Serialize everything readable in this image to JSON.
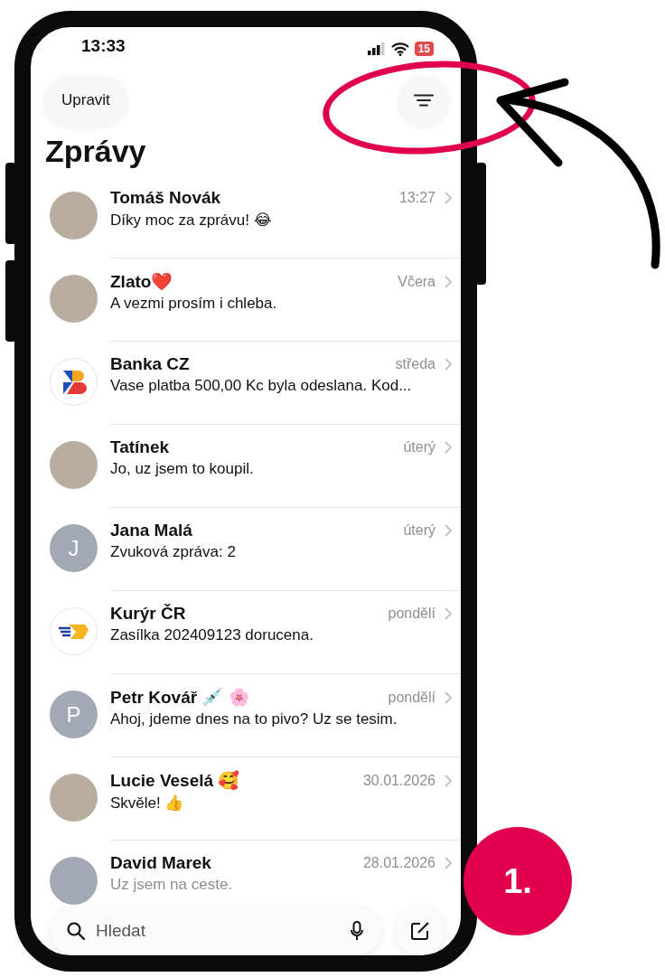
{
  "status_bar": {
    "time": "13:33",
    "battery": "15"
  },
  "header": {
    "edit_button": "Upravit",
    "title": "Zprávy"
  },
  "conversations": [
    {
      "name": "Tomáš Novák",
      "preview": "Díky moc za zprávu! 😂",
      "date": "13:27",
      "avatar": {
        "kind": "photo"
      }
    },
    {
      "name": "Zlato❤️",
      "preview": "A vezmi prosím i chleba.",
      "date": "Včera",
      "avatar": {
        "kind": "photo"
      }
    },
    {
      "name": "Banka CZ",
      "preview": "Vase platba 500,00 Kc byla odeslana. Kod...",
      "date": "středa",
      "avatar": {
        "kind": "bank-logo"
      }
    },
    {
      "name": "Tatínek",
      "preview": "Jo, uz jsem to koupil.",
      "date": "úterý",
      "avatar": {
        "kind": "photo"
      }
    },
    {
      "name": "Jana Malá",
      "preview": "Zvuková zpráva: 2",
      "date": "úterý",
      "avatar": {
        "kind": "initial",
        "letter": "J"
      }
    },
    {
      "name": "Kurýr ČR",
      "preview": "Zasílka 202409123 dorucena.",
      "date": "pondělí",
      "avatar": {
        "kind": "courier-logo"
      }
    },
    {
      "name": "Petr Kovář 💉 🌸",
      "preview": "Ahoj, jdeme dnes na to pivo? Uz se tesim.",
      "date": "pondělí",
      "avatar": {
        "kind": "initial",
        "letter": "P"
      }
    },
    {
      "name": "Lucie Veselá 🥰",
      "preview": "Skvěle! 👍",
      "date": "30.01.2026",
      "avatar": {
        "kind": "photo"
      }
    },
    {
      "name": "David Marek",
      "preview": "Uz jsem na ceste.",
      "date": "28.01.2026",
      "avatar": {
        "kind": "blank"
      }
    }
  ],
  "search": {
    "placeholder": "Hledat"
  },
  "annotation": {
    "badge": "1."
  }
}
